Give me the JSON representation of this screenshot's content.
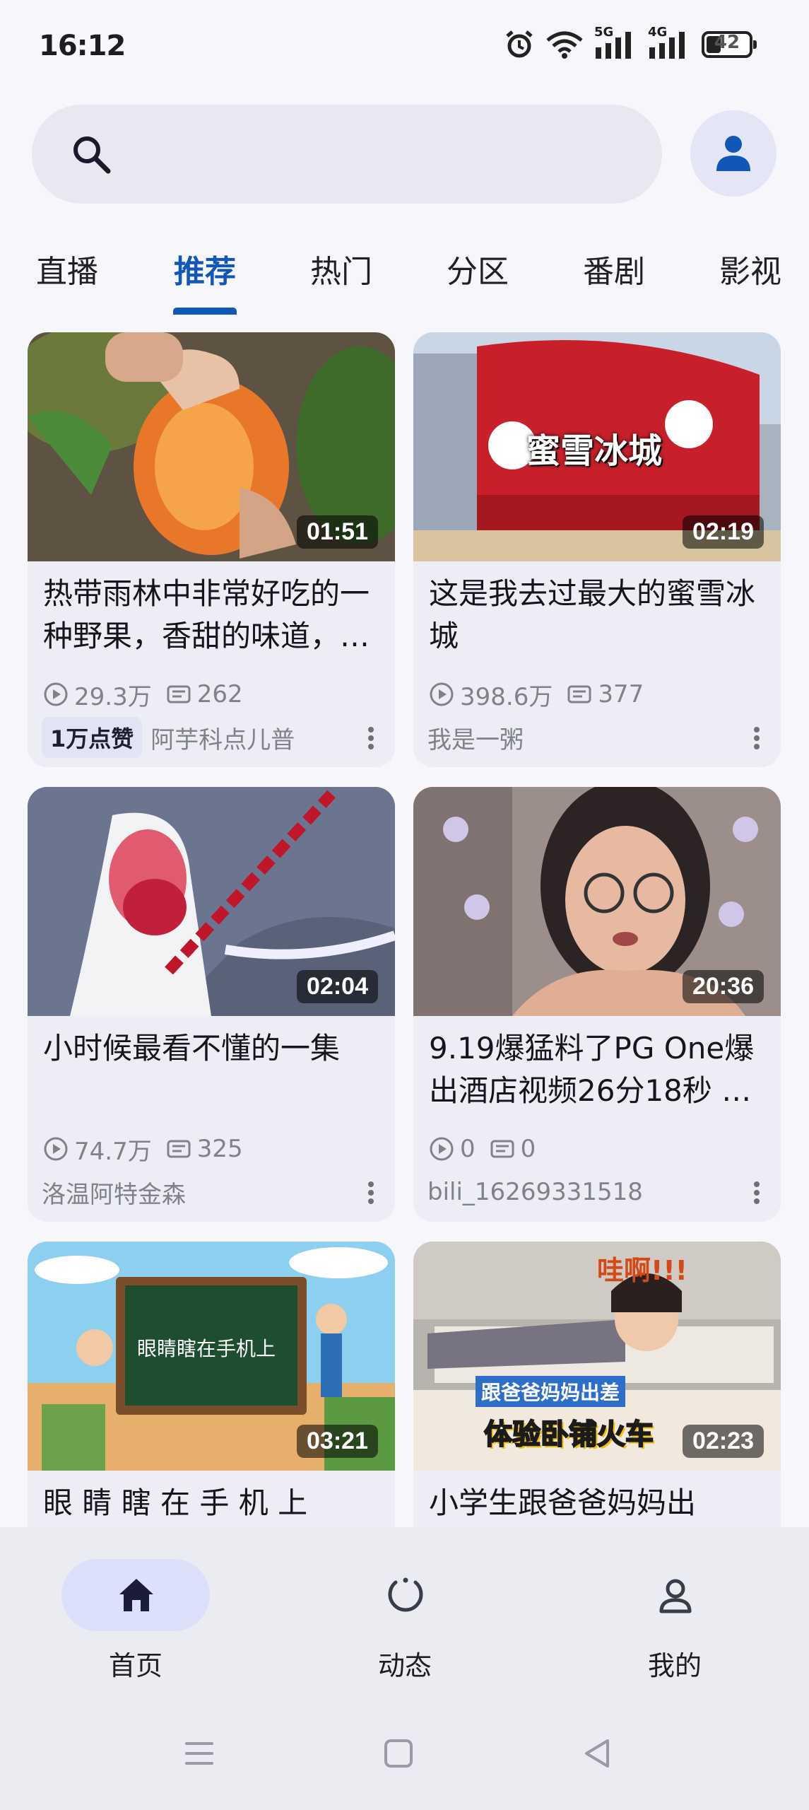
{
  "status_bar": {
    "time": "16:12",
    "network_1": "5G",
    "network_2": "4G",
    "battery": "42",
    "icons": [
      "alarm-icon",
      "wifi-icon",
      "signal-icon",
      "battery-icon"
    ]
  },
  "search": {
    "placeholder": "",
    "icon": "search-icon"
  },
  "profile_icon": "person-icon",
  "accent_color": "#1157b5",
  "tabs": [
    {
      "label": "直播"
    },
    {
      "label": "推荐",
      "active": true
    },
    {
      "label": "热门"
    },
    {
      "label": "分区"
    },
    {
      "label": "番剧"
    },
    {
      "label": "影视"
    }
  ],
  "videos": [
    {
      "title": "热带雨林中非常好吃的一种野果，香甜的味道，很多人都没有吃过",
      "duration": "01:51",
      "views": "29.3万",
      "danmaku": "262",
      "badge": "1万点赞",
      "author": "阿芋科点儿普"
    },
    {
      "title": "这是我去过最大的蜜雪冰城",
      "duration": "02:19",
      "thumb_caption": "蜜雪冰城",
      "views": "398.6万",
      "danmaku": "377",
      "author": "我是一粥"
    },
    {
      "title": "小时候最看不懂的一集",
      "duration": "02:04",
      "views": "74.7万",
      "danmaku": "325",
      "author": "洛温阿特金森"
    },
    {
      "title": "9.19爆猛料了PG One爆出酒店视频26分18秒 …",
      "duration": "20:36",
      "views": "0",
      "danmaku": "0",
      "author": "bili_16269331518"
    },
    {
      "title": "眼 睛 瞎 在 手 机 上",
      "duration": "03:21",
      "thumb_caption": "眼睛瞎在手机上"
    },
    {
      "title": "小学生跟爸爸妈妈出",
      "duration": "02:23",
      "thumb_caption_top": "哇啊!!!",
      "thumb_caption_1": "跟爸爸妈妈出差",
      "thumb_caption_2": "体验卧铺火车"
    }
  ],
  "bottom_nav": [
    {
      "label": "首页",
      "icon": "home-icon",
      "active": true
    },
    {
      "label": "动态",
      "icon": "dynamic-icon"
    },
    {
      "label": "我的",
      "icon": "profile-icon"
    }
  ],
  "system_nav": [
    "menu-icon",
    "home-square-icon",
    "back-icon"
  ]
}
